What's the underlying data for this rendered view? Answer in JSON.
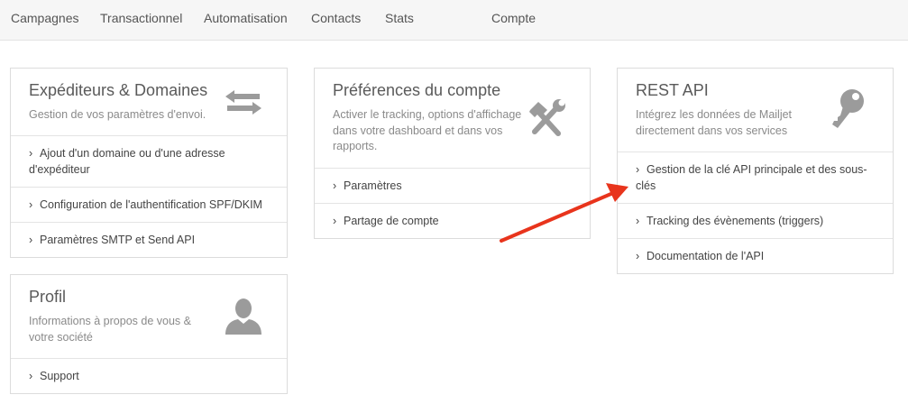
{
  "nav": {
    "items": [
      "Campagnes",
      "Transactionnel",
      "Automatisation",
      "Contacts",
      "Stats",
      "Compte"
    ]
  },
  "cards": {
    "senders": {
      "title": "Expéditeurs & Domaines",
      "description": "Gestion de vos paramètres d'envoi.",
      "icon": "transfer-arrows-icon",
      "links": [
        "Ajout d'un domaine ou d'une adresse d'expéditeur",
        "Configuration de l'authentification SPF/DKIM",
        "Paramètres SMTP et Send API"
      ]
    },
    "preferences": {
      "title": "Préférences du compte",
      "description": "Activer le tracking, options d'affichage dans votre dashboard et dans vos rapports.",
      "icon": "hammer-wrench-icon",
      "links": [
        "Paramètres",
        "Partage de compte"
      ]
    },
    "restapi": {
      "title": "REST API",
      "description": "Intégrez les données de Mailjet directement dans vos services",
      "icon": "key-icon",
      "links": [
        "Gestion de la clé API principale et des sous-clés",
        "Tracking des évènements (triggers)",
        "Documentation de l'API"
      ]
    },
    "profile": {
      "title": "Profil",
      "description": "Informations à propos de vous & votre société",
      "icon": "user-icon",
      "links": [
        "Support"
      ]
    }
  },
  "colors": {
    "annotation_arrow": "#e8341c",
    "icon_gray": "#9b9b9b",
    "nav_bg": "#f6f6f6"
  }
}
